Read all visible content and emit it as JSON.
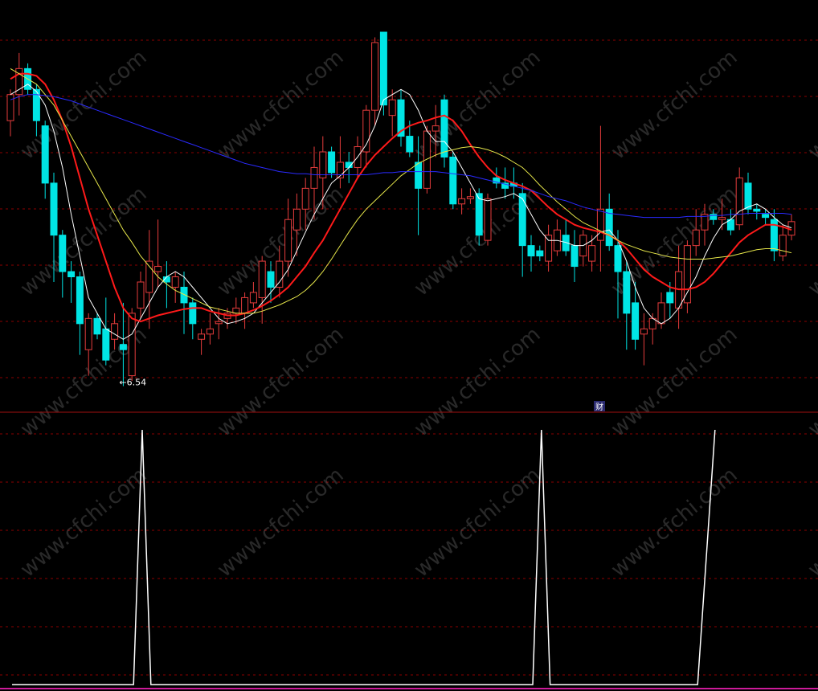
{
  "colors": {
    "background": "#000000",
    "grid": "#8b0000",
    "divider": "#a01010",
    "up": "#e63c3c",
    "down": "#00e5e5",
    "ma_white": "#ffffff",
    "ma_red": "#ff1a1a",
    "ma_yellow": "#e6e64a",
    "ma_blue": "#2a2aff",
    "signal": "#ffffff"
  },
  "watermark": "www.cfchi.com",
  "low_marker": {
    "label": "←6.54",
    "value": 6.54
  },
  "divider_marker": "财",
  "chart_data": [
    {
      "type": "candlestick",
      "title": "",
      "ylim": [
        6.35,
        9.9
      ],
      "grid": true,
      "candles": [
        [
          9.05,
          9.35,
          8.9,
          9.3
        ],
        [
          9.3,
          9.7,
          9.1,
          9.55
        ],
        [
          9.55,
          9.6,
          9.3,
          9.35
        ],
        [
          9.35,
          9.4,
          8.9,
          9.05
        ],
        [
          9.0,
          9.05,
          8.3,
          8.45
        ],
        [
          8.45,
          8.55,
          7.5,
          7.95
        ],
        [
          7.95,
          8.0,
          7.35,
          7.6
        ],
        [
          7.6,
          7.7,
          7.3,
          7.55
        ],
        [
          7.55,
          7.6,
          6.8,
          7.1
        ],
        [
          6.85,
          7.2,
          6.6,
          7.15
        ],
        [
          7.15,
          7.2,
          6.95,
          7.0
        ],
        [
          7.05,
          7.35,
          6.7,
          6.75
        ],
        [
          6.95,
          7.2,
          6.85,
          7.1
        ],
        [
          6.9,
          7.3,
          6.5,
          6.85
        ],
        [
          6.6,
          7.25,
          6.55,
          7.2
        ],
        [
          7.25,
          7.6,
          7.15,
          7.5
        ],
        [
          7.4,
          8.0,
          7.05,
          7.7
        ],
        [
          7.6,
          8.1,
          7.45,
          7.65
        ],
        [
          7.55,
          7.7,
          7.25,
          7.5
        ],
        [
          7.45,
          7.6,
          7.3,
          7.55
        ],
        [
          7.45,
          7.6,
          7.0,
          7.3
        ],
        [
          7.3,
          7.35,
          6.95,
          7.1
        ],
        [
          6.95,
          7.05,
          6.8,
          7.0
        ],
        [
          7.0,
          7.2,
          6.9,
          7.05
        ],
        [
          7.1,
          7.25,
          6.95,
          7.12
        ],
        [
          7.15,
          7.25,
          7.05,
          7.2
        ],
        [
          7.2,
          7.35,
          7.1,
          7.25
        ],
        [
          7.2,
          7.4,
          7.05,
          7.35
        ],
        [
          7.3,
          7.5,
          7.25,
          7.4
        ],
        [
          7.35,
          7.75,
          7.1,
          7.7
        ],
        [
          7.6,
          7.7,
          7.3,
          7.45
        ],
        [
          7.45,
          7.85,
          7.35,
          7.7
        ],
        [
          7.7,
          8.3,
          7.55,
          8.1
        ],
        [
          8.0,
          8.35,
          7.75,
          8.2
        ],
        [
          8.2,
          8.5,
          8.0,
          8.4
        ],
        [
          8.4,
          8.8,
          8.1,
          8.6
        ],
        [
          8.5,
          8.9,
          8.2,
          8.75
        ],
        [
          8.75,
          8.8,
          8.5,
          8.55
        ],
        [
          8.5,
          8.9,
          8.4,
          8.65
        ],
        [
          8.65,
          8.75,
          8.45,
          8.6
        ],
        [
          8.6,
          8.9,
          8.5,
          8.8
        ],
        [
          8.75,
          9.2,
          8.6,
          9.15
        ],
        [
          9.15,
          9.85,
          9.0,
          9.8
        ],
        [
          9.9,
          9.9,
          9.1,
          9.2
        ],
        [
          9.1,
          9.35,
          8.9,
          9.25
        ],
        [
          9.25,
          9.35,
          8.8,
          8.9
        ],
        [
          8.9,
          9.05,
          8.7,
          8.75
        ],
        [
          8.65,
          8.9,
          7.95,
          8.4
        ],
        [
          8.4,
          9.0,
          8.35,
          8.95
        ],
        [
          8.95,
          9.2,
          8.7,
          9.0
        ],
        [
          9.25,
          9.3,
          8.6,
          8.7
        ],
        [
          8.7,
          8.75,
          8.2,
          8.25
        ],
        [
          8.25,
          8.4,
          8.15,
          8.3
        ],
        [
          8.3,
          8.4,
          8.25,
          8.32
        ],
        [
          8.35,
          8.4,
          7.85,
          7.95
        ],
        [
          7.9,
          8.35,
          7.85,
          8.3
        ],
        [
          8.5,
          8.6,
          8.4,
          8.45
        ],
        [
          8.45,
          8.6,
          8.3,
          8.4
        ],
        [
          8.45,
          8.6,
          8.3,
          8.42
        ],
        [
          8.35,
          8.45,
          7.55,
          7.85
        ],
        [
          7.85,
          7.95,
          7.6,
          7.75
        ],
        [
          7.8,
          7.85,
          7.7,
          7.75
        ],
        [
          7.7,
          8.05,
          7.6,
          7.95
        ],
        [
          7.8,
          8.1,
          7.75,
          8.0
        ],
        [
          7.95,
          8.1,
          7.75,
          7.8
        ],
        [
          7.85,
          8.0,
          7.5,
          7.65
        ],
        [
          7.75,
          8.0,
          7.65,
          7.95
        ],
        [
          7.7,
          7.95,
          7.6,
          7.85
        ],
        [
          7.9,
          9.0,
          7.6,
          8.2
        ],
        [
          8.2,
          8.35,
          7.8,
          7.85
        ],
        [
          7.85,
          8.0,
          7.15,
          7.6
        ],
        [
          7.6,
          7.7,
          6.85,
          7.2
        ],
        [
          7.3,
          7.5,
          6.85,
          6.95
        ],
        [
          7.0,
          7.2,
          6.7,
          7.05
        ],
        [
          7.05,
          7.2,
          6.9,
          7.15
        ],
        [
          7.1,
          7.4,
          7.05,
          7.3
        ],
        [
          7.4,
          7.5,
          7.15,
          7.3
        ],
        [
          7.25,
          7.85,
          7.05,
          7.6
        ],
        [
          7.3,
          7.9,
          7.2,
          7.85
        ],
        [
          7.85,
          8.2,
          7.75,
          8.0
        ],
        [
          8.0,
          8.25,
          7.85,
          8.15
        ],
        [
          8.15,
          8.2,
          8.05,
          8.1
        ],
        [
          8.1,
          8.3,
          8.0,
          8.12
        ],
        [
          8.1,
          8.2,
          7.95,
          8.0
        ],
        [
          8.05,
          8.6,
          8.0,
          8.5
        ],
        [
          8.45,
          8.55,
          8.15,
          8.2
        ],
        [
          8.2,
          8.25,
          8.1,
          8.18
        ],
        [
          8.15,
          8.2,
          8.05,
          8.12
        ],
        [
          8.1,
          8.2,
          7.7,
          7.8
        ],
        [
          7.75,
          8.05,
          7.7,
          7.95
        ],
        [
          7.95,
          8.15,
          7.9,
          8.08
        ]
      ],
      "moving_averages": [
        {
          "name": "",
          "color": "#ffffff",
          "values": [
            9.3,
            9.35,
            9.4,
            9.33,
            9.2,
            8.95,
            8.6,
            8.15,
            7.75,
            7.35,
            7.2,
            7.05,
            7.0,
            6.95,
            7.0,
            7.15,
            7.3,
            7.45,
            7.55,
            7.6,
            7.55,
            7.45,
            7.35,
            7.25,
            7.15,
            7.1,
            7.12,
            7.15,
            7.2,
            7.3,
            7.4,
            7.5,
            7.62,
            7.8,
            7.98,
            8.15,
            8.3,
            8.45,
            8.52,
            8.6,
            8.7,
            8.82,
            9.0,
            9.25,
            9.3,
            9.35,
            9.3,
            9.15,
            8.95,
            8.85,
            8.85,
            8.75,
            8.6,
            8.45,
            8.3,
            8.28,
            8.3,
            8.32,
            8.35,
            8.3,
            8.15,
            8.0,
            7.9,
            7.9,
            7.88,
            7.85,
            7.85,
            7.9,
            7.98,
            8.0,
            7.9,
            7.7,
            7.45,
            7.25,
            7.15,
            7.1,
            7.15,
            7.25,
            7.4,
            7.55,
            7.75,
            7.92,
            8.05,
            8.1,
            8.18,
            8.22,
            8.25,
            8.2,
            8.12,
            8.05,
            8.02
          ]
        },
        {
          "name": "",
          "color": "#ff1a1a",
          "values": [
            9.45,
            9.5,
            9.5,
            9.48,
            9.4,
            9.25,
            9.05,
            8.8,
            8.5,
            8.2,
            7.95,
            7.7,
            7.45,
            7.25,
            7.15,
            7.12,
            7.15,
            7.18,
            7.2,
            7.22,
            7.24,
            7.25,
            7.25,
            7.22,
            7.2,
            7.18,
            7.18,
            7.2,
            7.23,
            7.27,
            7.32,
            7.38,
            7.45,
            7.55,
            7.65,
            7.78,
            7.9,
            8.05,
            8.2,
            8.35,
            8.5,
            8.62,
            8.72,
            8.8,
            8.88,
            8.95,
            9.0,
            9.03,
            9.05,
            9.08,
            9.1,
            9.05,
            8.95,
            8.82,
            8.7,
            8.6,
            8.52,
            8.48,
            8.45,
            8.42,
            8.38,
            8.3,
            8.22,
            8.15,
            8.1,
            8.05,
            8.02,
            8.0,
            7.98,
            7.95,
            7.9,
            7.82,
            7.72,
            7.62,
            7.55,
            7.5,
            7.45,
            7.43,
            7.43,
            7.45,
            7.5,
            7.58,
            7.68,
            7.78,
            7.88,
            7.95,
            8.0,
            8.05,
            8.05,
            8.03,
            8.0
          ]
        },
        {
          "name": "",
          "color": "#e6e64a",
          "values": [
            9.55,
            9.5,
            9.45,
            9.4,
            9.3,
            9.2,
            9.05,
            8.9,
            8.75,
            8.6,
            8.45,
            8.3,
            8.15,
            8.0,
            7.88,
            7.75,
            7.65,
            7.55,
            7.48,
            7.42,
            7.38,
            7.34,
            7.3,
            7.26,
            7.24,
            7.22,
            7.2,
            7.2,
            7.2,
            7.22,
            7.25,
            7.28,
            7.32,
            7.36,
            7.42,
            7.5,
            7.6,
            7.72,
            7.85,
            7.98,
            8.1,
            8.2,
            8.28,
            8.36,
            8.44,
            8.52,
            8.58,
            8.64,
            8.68,
            8.72,
            8.75,
            8.77,
            8.79,
            8.8,
            8.79,
            8.77,
            8.74,
            8.7,
            8.65,
            8.6,
            8.52,
            8.43,
            8.35,
            8.27,
            8.2,
            8.13,
            8.07,
            8.03,
            7.99,
            7.95,
            7.9,
            7.86,
            7.83,
            7.8,
            7.78,
            7.76,
            7.74,
            7.73,
            7.72,
            7.72,
            7.72,
            7.73,
            7.74,
            7.75,
            7.77,
            7.79,
            7.81,
            7.82,
            7.82,
            7.8,
            7.78
          ]
        },
        {
          "name": "",
          "color": "#2a2aff",
          "values": [
            9.25,
            9.28,
            9.3,
            9.3,
            9.29,
            9.28,
            9.26,
            9.24,
            9.21,
            9.18,
            9.15,
            9.12,
            9.09,
            9.06,
            9.03,
            9.0,
            8.97,
            8.94,
            8.91,
            8.88,
            8.85,
            8.82,
            8.79,
            8.76,
            8.73,
            8.7,
            8.67,
            8.64,
            8.62,
            8.6,
            8.58,
            8.56,
            8.55,
            8.54,
            8.54,
            8.53,
            8.53,
            8.53,
            8.53,
            8.53,
            8.53,
            8.53,
            8.54,
            8.55,
            8.55,
            8.56,
            8.56,
            8.56,
            8.56,
            8.56,
            8.55,
            8.54,
            8.53,
            8.52,
            8.5,
            8.48,
            8.46,
            8.44,
            8.42,
            8.4,
            8.38,
            8.35,
            8.32,
            8.3,
            8.28,
            8.25,
            8.22,
            8.2,
            8.18,
            8.16,
            8.15,
            8.14,
            8.13,
            8.12,
            8.12,
            8.12,
            8.12,
            8.12,
            8.13,
            8.13,
            8.13,
            8.14,
            8.14,
            8.15,
            8.15,
            8.16,
            8.16,
            8.16,
            8.16,
            8.16,
            8.15
          ]
        }
      ]
    },
    {
      "type": "line",
      "title": "",
      "ylim": [
        0,
        1
      ],
      "series": [
        {
          "name": "",
          "color": "#ffffff",
          "points": [
            [
              0,
              0
            ],
            [
              14,
              0
            ],
            [
              15,
              1
            ],
            [
              16,
              0
            ],
            [
              60,
              0
            ],
            [
              61,
              1
            ],
            [
              62,
              0
            ],
            [
              79,
              0
            ],
            [
              81,
              1
            ]
          ]
        }
      ]
    }
  ]
}
